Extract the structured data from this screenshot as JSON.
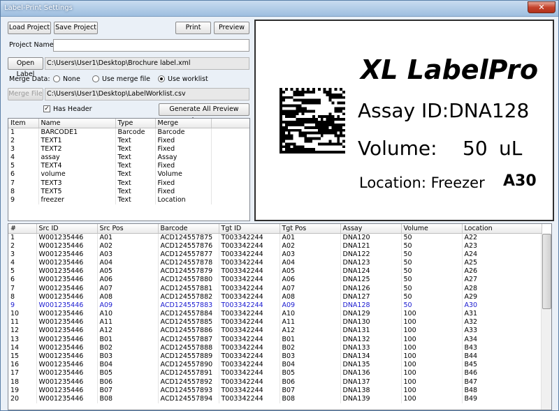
{
  "window": {
    "title": "Label-Print Settings",
    "close_glyph": "✕"
  },
  "toolbar": {
    "load_project": "Load Project",
    "save_project": "Save Project",
    "print": "Print",
    "preview": "Preview"
  },
  "project": {
    "label": "Project Name:",
    "value": ""
  },
  "open_label": {
    "button": "Open Label",
    "path": "C:\\Users\\User1\\Desktop\\Brochure label.xml"
  },
  "merge": {
    "label": "Merge Data:",
    "options": [
      "None",
      "Use merge file",
      "Use worklist"
    ],
    "selected": "Use worklist",
    "merge_file_button": "Merge File",
    "path": "C:\\Users\\User1\\Desktop\\LabelWorklist.csv",
    "has_header_label": "Has Header",
    "has_header_checked": true,
    "generate_button": "Generate All Preview Images"
  },
  "items_table": {
    "columns": [
      "Item",
      "Name",
      "Type",
      "Merge"
    ],
    "rows": [
      [
        "1",
        "BARCODE1",
        "Barcode",
        "Barcode"
      ],
      [
        "2",
        "TEXT1",
        "Text",
        "Fixed"
      ],
      [
        "3",
        "TEXT2",
        "Text",
        "Fixed"
      ],
      [
        "4",
        "assay",
        "Text",
        "Assay"
      ],
      [
        "5",
        "TEXT4",
        "Text",
        "Fixed"
      ],
      [
        "6",
        "volume",
        "Text",
        "Volume"
      ],
      [
        "7",
        "TEXT3",
        "Text",
        "Fixed"
      ],
      [
        "8",
        "TEXT5",
        "Text",
        "Fixed"
      ],
      [
        "9",
        "freezer",
        "Text",
        "Location"
      ]
    ]
  },
  "label_preview": {
    "title": "XL LabelPro",
    "assay": "Assay ID:DNA128",
    "volume_label": "Volume:",
    "volume_value": "50",
    "volume_unit": "uL",
    "location_label": "Location: Freezer",
    "location_value": "A30"
  },
  "worklist": {
    "columns": [
      "#",
      "Src ID",
      "Src Pos",
      "Barcode",
      "Tgt ID",
      "Tgt Pos",
      "Assay",
      "Volume",
      "Location"
    ],
    "selected_row": 9,
    "rows": [
      [
        "1",
        "W001235446",
        "A01",
        "ACD124557875",
        "T003342244",
        "A01",
        "DNA120",
        "50",
        "A22"
      ],
      [
        "2",
        "W001235446",
        "A02",
        "ACD124557876",
        "T003342244",
        "A02",
        "DNA121",
        "50",
        "A23"
      ],
      [
        "3",
        "W001235446",
        "A03",
        "ACD124557877",
        "T003342244",
        "A03",
        "DNA122",
        "50",
        "A24"
      ],
      [
        "4",
        "W001235446",
        "A04",
        "ACD124557878",
        "T003342244",
        "A04",
        "DNA123",
        "50",
        "A25"
      ],
      [
        "5",
        "W001235446",
        "A05",
        "ACD124557879",
        "T003342244",
        "A05",
        "DNA124",
        "50",
        "A26"
      ],
      [
        "6",
        "W001235446",
        "A06",
        "ACD124557880",
        "T003342244",
        "A06",
        "DNA125",
        "50",
        "A27"
      ],
      [
        "7",
        "W001235446",
        "A07",
        "ACD124557881",
        "T003342244",
        "A07",
        "DNA126",
        "50",
        "A28"
      ],
      [
        "8",
        "W001235446",
        "A08",
        "ACD124557882",
        "T003342244",
        "A08",
        "DNA127",
        "50",
        "A29"
      ],
      [
        "9",
        "W001235446",
        "A09",
        "ACD124557883",
        "T003342244",
        "A09",
        "DNA128",
        "50",
        "A30"
      ],
      [
        "10",
        "W001235446",
        "A10",
        "ACD124557884",
        "T003342244",
        "A10",
        "DNA129",
        "100",
        "A31"
      ],
      [
        "11",
        "W001235446",
        "A11",
        "ACD124557885",
        "T003342244",
        "A11",
        "DNA130",
        "100",
        "A32"
      ],
      [
        "12",
        "W001235446",
        "A12",
        "ACD124557886",
        "T003342244",
        "A12",
        "DNA131",
        "100",
        "A33"
      ],
      [
        "13",
        "W001235446",
        "B01",
        "ACD124557887",
        "T003342244",
        "B01",
        "DNA132",
        "100",
        "A34"
      ],
      [
        "14",
        "W001235446",
        "B02",
        "ACD124557888",
        "T003342244",
        "B02",
        "DNA133",
        "100",
        "B43"
      ],
      [
        "15",
        "W001235446",
        "B03",
        "ACD124557889",
        "T003342244",
        "B03",
        "DNA134",
        "100",
        "B44"
      ],
      [
        "16",
        "W001235446",
        "B04",
        "ACD124557890",
        "T003342244",
        "B04",
        "DNA135",
        "100",
        "B45"
      ],
      [
        "17",
        "W001235446",
        "B05",
        "ACD124557891",
        "T003342244",
        "B05",
        "DNA136",
        "100",
        "B46"
      ],
      [
        "18",
        "W001235446",
        "B06",
        "ACD124557892",
        "T003342244",
        "B06",
        "DNA137",
        "100",
        "B47"
      ],
      [
        "19",
        "W001235446",
        "B07",
        "ACD124557893",
        "T003342244",
        "B07",
        "DNA138",
        "100",
        "B48"
      ],
      [
        "20",
        "W001235446",
        "B08",
        "ACD124557894",
        "T003342244",
        "B08",
        "DNA139",
        "100",
        "B49"
      ]
    ]
  },
  "icons": {
    "close": "close-icon",
    "barcode": "datamatrix-barcode-icon"
  },
  "colors": {
    "selected_row_text": "#1a1ad0",
    "title_bar": "#9ebedf",
    "close_button": "#c4432c"
  }
}
